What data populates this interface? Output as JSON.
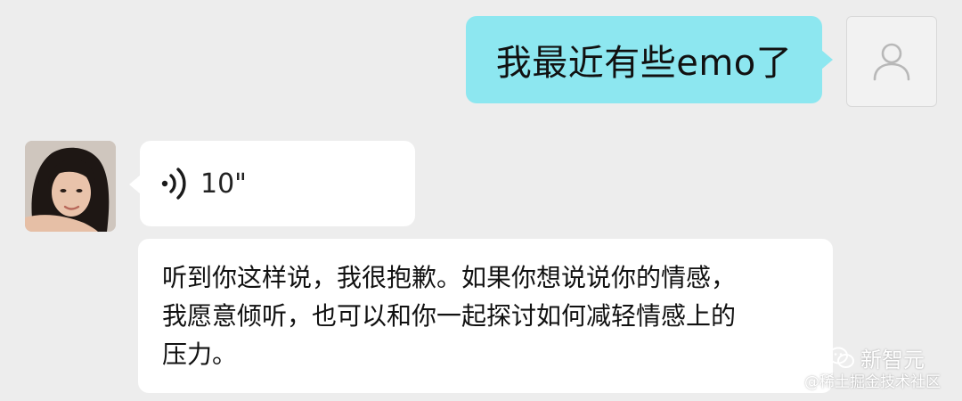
{
  "conversation": {
    "outgoing_message": "我最近有些emo了",
    "voice_message": {
      "icon": "voice-wave-icon",
      "duration": "10\""
    },
    "reply_lines": [
      "听到你这样说，我很抱歉。如果你想说说你的情感，",
      "我愿意倾听，也可以和你一起探讨如何减轻情感上的",
      "压力。"
    ]
  },
  "avatars": {
    "self": "user-placeholder-icon",
    "peer": "peer-photo"
  },
  "watermark": {
    "brand": "新智元",
    "site": "@稀土掘金技术社区"
  },
  "colors": {
    "background": "#ededed",
    "outgoing_bubble": "#8de7f0",
    "incoming_bubble": "#ffffff"
  }
}
